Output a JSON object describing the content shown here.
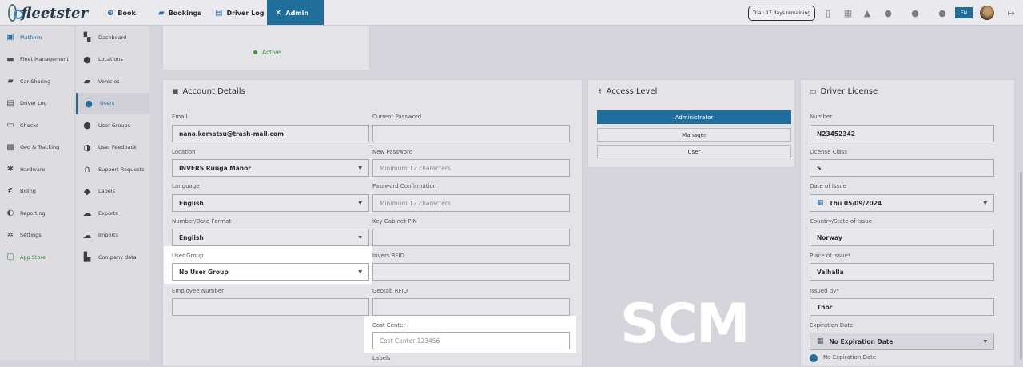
{
  "brand": {
    "name": "fleetster"
  },
  "nav": [
    {
      "label": "Book",
      "icon": "plus-circle-icon"
    },
    {
      "label": "Bookings",
      "icon": "car-icon"
    },
    {
      "label": "Driver Log",
      "icon": "logbook-icon"
    },
    {
      "label": "Admin",
      "icon": "tools-icon",
      "active": true
    }
  ],
  "topbar": {
    "trial": "Trial: 17 days remaining",
    "language": "EN"
  },
  "sidebar_primary": [
    {
      "label": "Platform",
      "icon": "platform-icon",
      "active": true
    },
    {
      "label": "Fleet Management",
      "icon": "fleet-icon"
    },
    {
      "label": "Car Sharing",
      "icon": "car-sharing-icon"
    },
    {
      "label": "Driver Log",
      "icon": "driver-log-icon"
    },
    {
      "label": "Checks",
      "icon": "checks-icon"
    },
    {
      "label": "Geo & Tracking",
      "icon": "tracking-icon"
    },
    {
      "label": "Hardware",
      "icon": "hardware-icon"
    },
    {
      "label": "Billing",
      "icon": "euro-icon"
    },
    {
      "label": "Reporting",
      "icon": "reporting-icon"
    },
    {
      "label": "Settings",
      "icon": "settings-icon"
    },
    {
      "label": "App Store",
      "icon": "app-store-icon"
    }
  ],
  "sidebar_secondary": [
    {
      "label": "Dashboard",
      "icon": "dashboard-icon"
    },
    {
      "label": "Locations",
      "icon": "location-pin-icon"
    },
    {
      "label": "Vehicles",
      "icon": "vehicle-icon"
    },
    {
      "label": "Users",
      "icon": "user-icon",
      "active": true
    },
    {
      "label": "User Groups",
      "icon": "user-groups-icon"
    },
    {
      "label": "User Feedback",
      "icon": "feedback-icon"
    },
    {
      "label": "Support Requests",
      "icon": "headset-icon"
    },
    {
      "label": "Labels",
      "icon": "tag-icon"
    },
    {
      "label": "Exports",
      "icon": "cloud-upload-icon"
    },
    {
      "label": "Imports",
      "icon": "cloud-download-icon"
    },
    {
      "label": "Company data",
      "icon": "building-icon"
    }
  ],
  "status": {
    "label": "Active",
    "color": "#3d9a3d"
  },
  "account": {
    "title": "Account Details",
    "email": {
      "label": "Email",
      "value": "nana.komatsu@trash-mail.com"
    },
    "current_password": {
      "label": "Current Password",
      "value": ""
    },
    "location": {
      "label": "Location",
      "value": "INVERS Ruuga Manor"
    },
    "new_password": {
      "label": "New Password",
      "placeholder": "Minimum 12 characters"
    },
    "language": {
      "label": "Language",
      "value": "English"
    },
    "password_confirmation": {
      "label": "Password Confirmation",
      "placeholder": "Minimum 12 characters"
    },
    "number_format": {
      "label": "Number/Date Format",
      "value": "English"
    },
    "key_cabinet_pin": {
      "label": "Key Cabinet PIN",
      "value": ""
    },
    "user_group": {
      "label": "User Group",
      "value": "No User Group"
    },
    "invers_rfid": {
      "label": "Invers RFID",
      "value": ""
    },
    "employee_number": {
      "label": "Employee Number",
      "value": ""
    },
    "geotab_rfid": {
      "label": "Geotab RFID",
      "value": ""
    },
    "cost_center": {
      "label": "Cost Center",
      "placeholder": "Cost Center 123456"
    },
    "labels": {
      "label": "Labels"
    }
  },
  "access": {
    "title": "Access Level",
    "levels": [
      "Administrator",
      "Manager",
      "User"
    ],
    "selected": "Administrator"
  },
  "license": {
    "title": "Driver License",
    "number": {
      "label": "Number",
      "value": "N23452342"
    },
    "class": {
      "label": "License Class",
      "value": "S"
    },
    "date_of_issue": {
      "label": "Date of Issue",
      "value": "Thu 05/09/2024"
    },
    "country": {
      "label": "Country/State of Issue",
      "value": "Norway"
    },
    "place": {
      "label": "Place of issue*",
      "value": "Valhalla"
    },
    "issued_by": {
      "label": "Issued by*",
      "value": "Thor"
    },
    "expiration": {
      "label": "Expiration Date",
      "value": "No Expiration Date"
    },
    "no_expiration": {
      "label": "No Expiration Date",
      "checked": true
    }
  },
  "watermark": "SCM",
  "colors": {
    "accent": "#1f6e9c",
    "active_status": "#3d9a3d"
  }
}
